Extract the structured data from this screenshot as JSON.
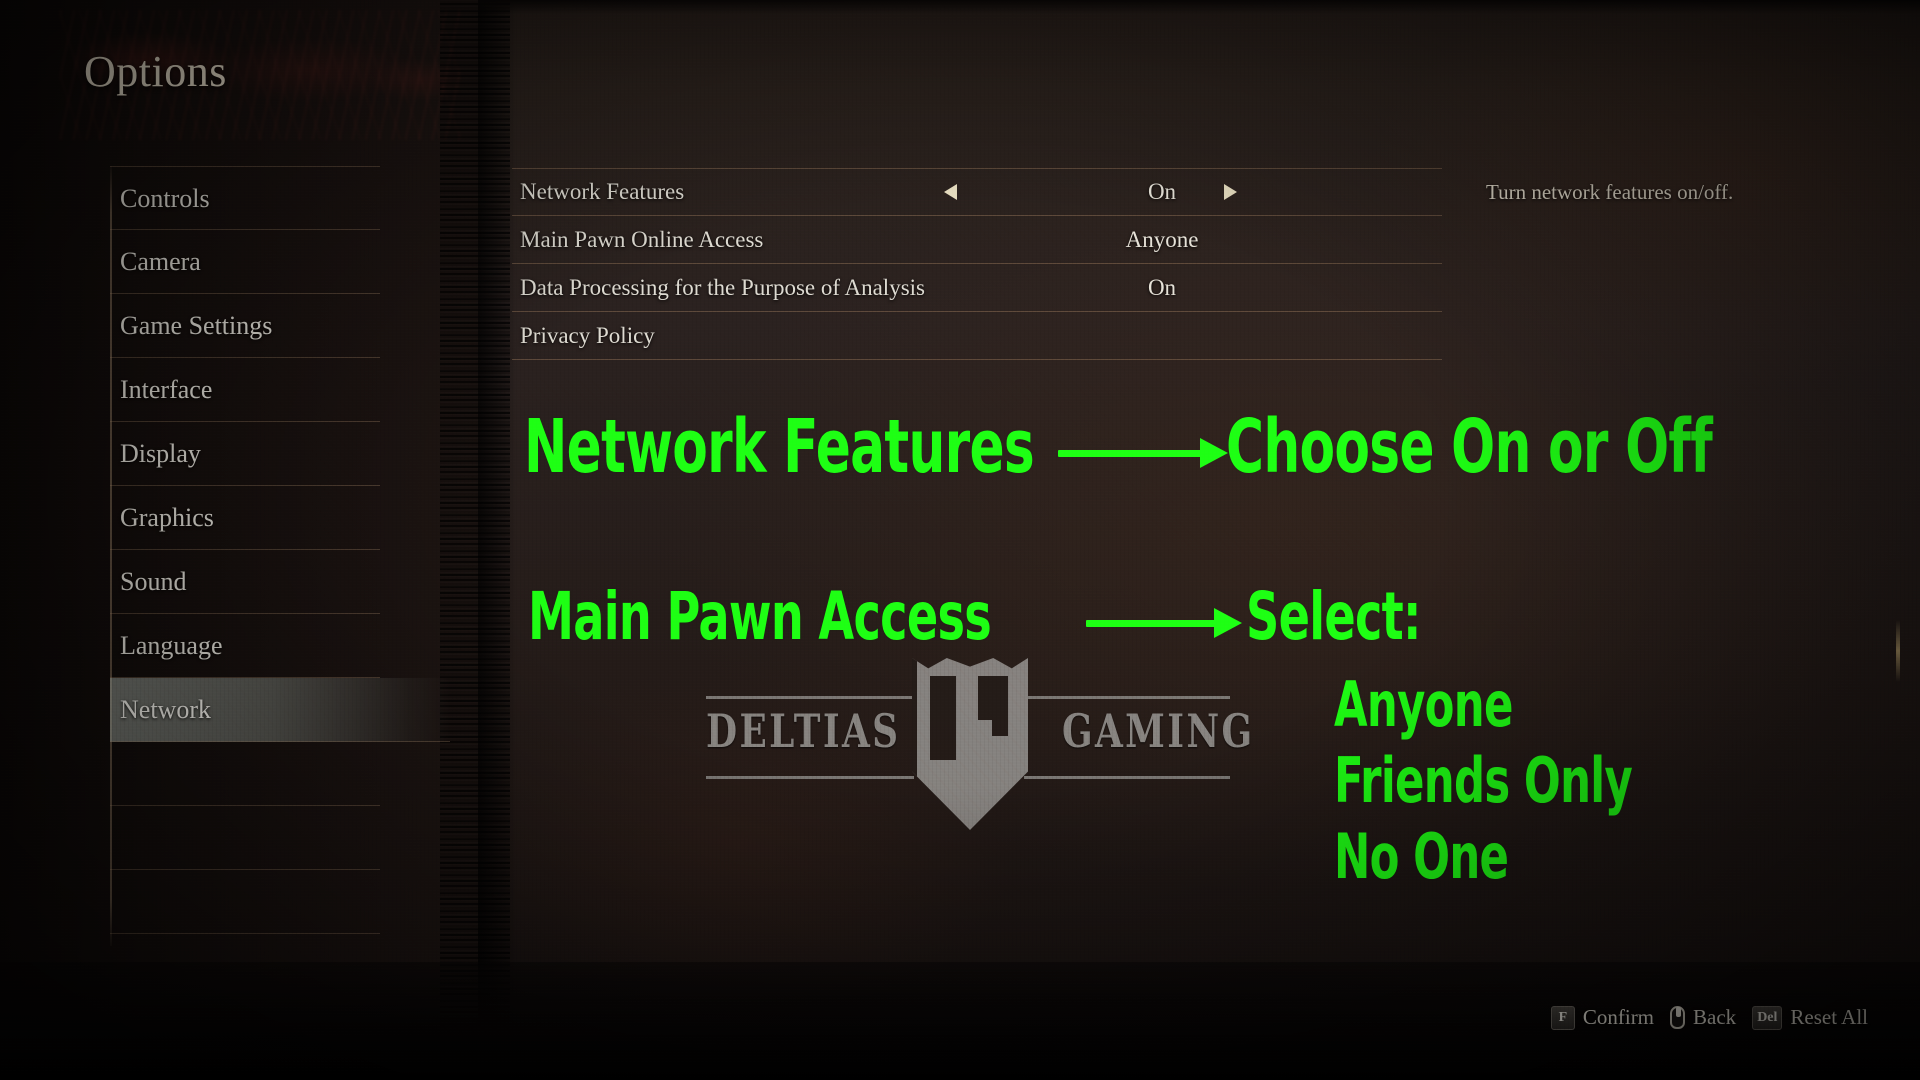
{
  "page": {
    "title": "Options"
  },
  "sidebar": {
    "items": [
      {
        "label": "Controls",
        "selected": false
      },
      {
        "label": "Camera",
        "selected": false
      },
      {
        "label": "Game Settings",
        "selected": false
      },
      {
        "label": "Interface",
        "selected": false
      },
      {
        "label": "Display",
        "selected": false
      },
      {
        "label": "Graphics",
        "selected": false
      },
      {
        "label": "Sound",
        "selected": false
      },
      {
        "label": "Language",
        "selected": false
      },
      {
        "label": "Network",
        "selected": true
      },
      {
        "label": "",
        "selected": false
      },
      {
        "label": "",
        "selected": false
      },
      {
        "label": "",
        "selected": false
      }
    ]
  },
  "settings": {
    "rows": [
      {
        "label": "Network Features",
        "value": "On",
        "has_arrows": true
      },
      {
        "label": "Main Pawn Online Access",
        "value": "Anyone",
        "has_arrows": false
      },
      {
        "label": "Data Processing for the Purpose of Analysis",
        "value": "On",
        "has_arrows": false
      },
      {
        "label": "Privacy Policy",
        "value": "",
        "has_arrows": false
      }
    ],
    "description": "Turn network features on/off."
  },
  "annotations": {
    "accent_color": "#1eff14",
    "line1_left": "Network Features",
    "line1_right": "Choose On or Off",
    "line2_left": "Main Pawn Access",
    "line2_right": "Select:",
    "option1": "Anyone",
    "option2": "Friends Only",
    "option3": "No One"
  },
  "watermark": {
    "left_word": "DELTIAS",
    "right_word": "GAMING",
    "monogram": "DG"
  },
  "footer": {
    "prompts": [
      {
        "key": "F",
        "type": "key",
        "label": "Confirm"
      },
      {
        "key": "",
        "type": "mouse",
        "label": "Back"
      },
      {
        "key": "Del",
        "type": "key",
        "label": "Reset All"
      }
    ]
  }
}
